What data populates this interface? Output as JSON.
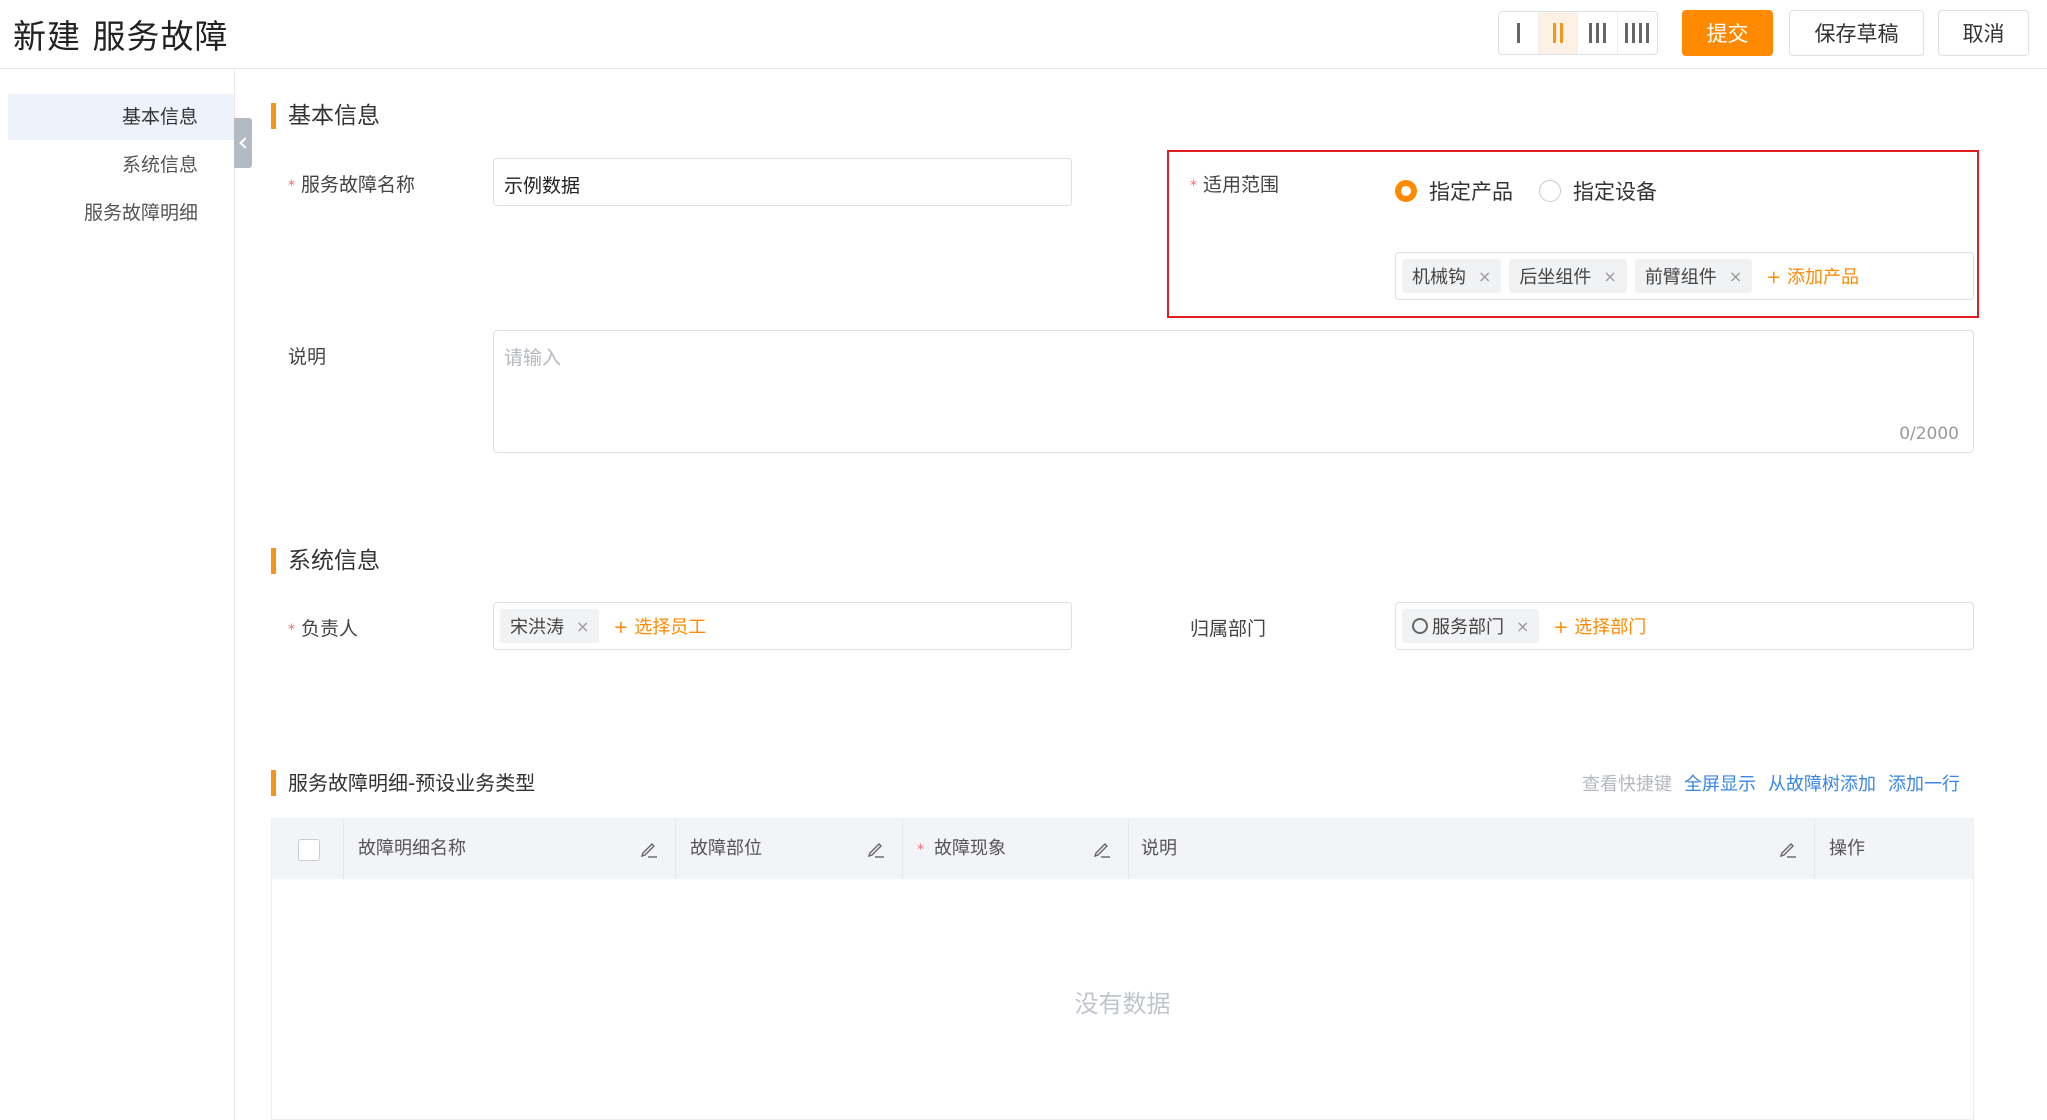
{
  "header": {
    "title": "新建 服务故障",
    "submit": "提交",
    "save_draft": "保存草稿",
    "cancel": "取消"
  },
  "sidebar": {
    "items": [
      {
        "label": "基本信息"
      },
      {
        "label": "系统信息"
      },
      {
        "label": "服务故障明细"
      }
    ]
  },
  "basic": {
    "section_title": "基本信息",
    "name_label": "服务故障名称",
    "name_value": "示例数据",
    "scope_label": "适用范围",
    "scope_options": [
      "指定产品",
      "指定设备"
    ],
    "products": [
      "机械钩",
      "后坐组件",
      "前臂组件"
    ],
    "add_product": "+ 添加产品",
    "desc_label": "说明",
    "desc_placeholder": "请输入",
    "desc_count": "0/2000"
  },
  "system": {
    "section_title": "系统信息",
    "owner_label": "负责人",
    "owner_tag": "宋洪涛",
    "select_employee": "+ 选择员工",
    "dept_label": "归属部门",
    "dept_tag": "服务部门",
    "select_dept": "+ 选择部门"
  },
  "detail": {
    "section_title": "服务故障明细-预设业务类型",
    "links": {
      "shortcut": "查看快捷键",
      "fullscreen": "全屏显示",
      "from_tree": "从故障树添加",
      "add_row": "添加一行"
    },
    "columns": [
      "故障明细名称",
      "故障部位",
      "故障现象",
      "说明",
      "操作"
    ],
    "empty_text": "没有数据"
  },
  "colors": {
    "accent": "#ff8a00",
    "link": "#3a87e5",
    "highlight_border": "#e02020"
  }
}
